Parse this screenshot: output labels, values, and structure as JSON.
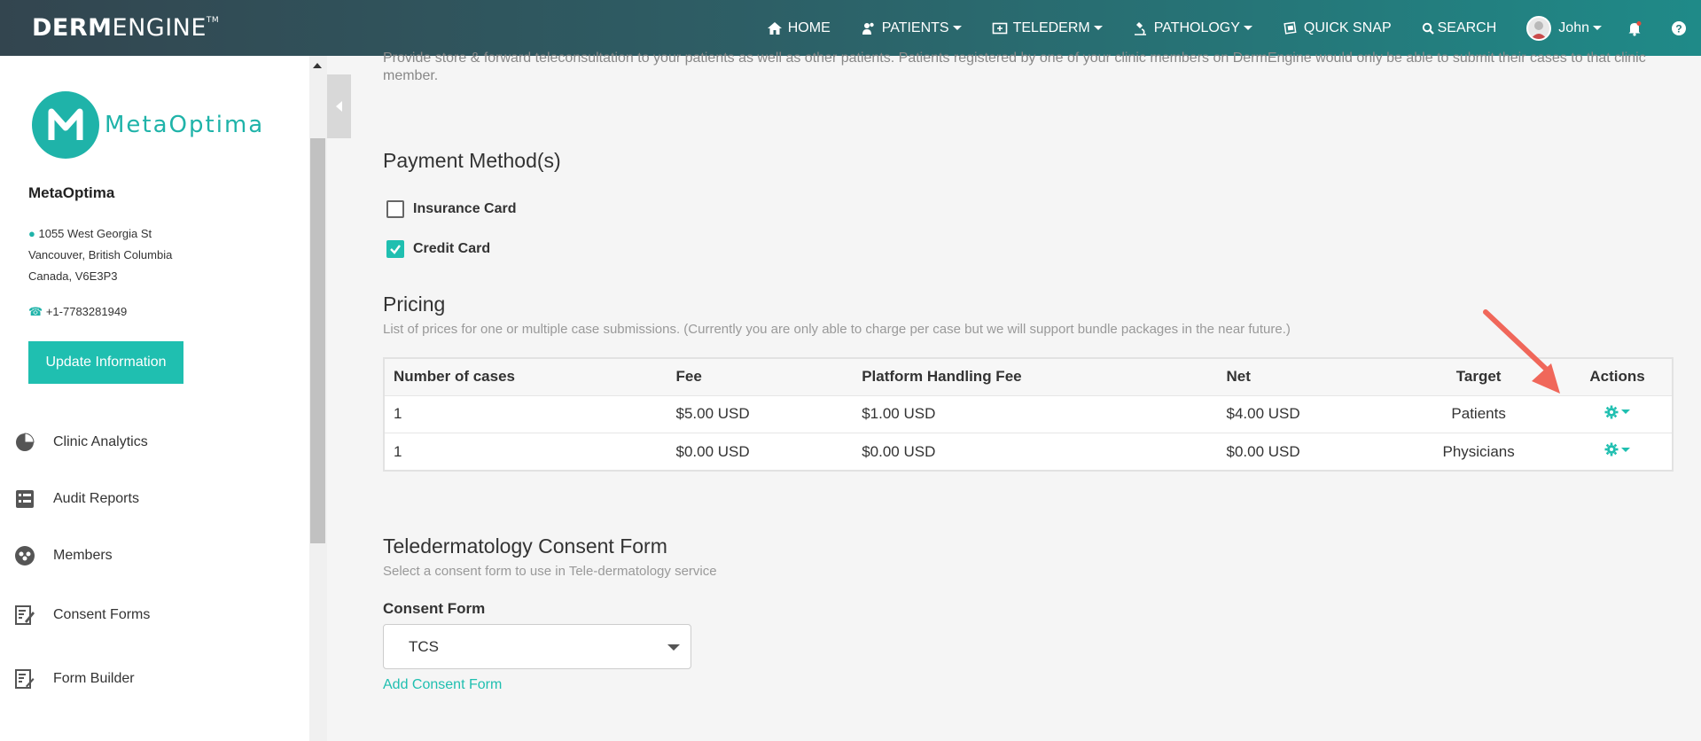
{
  "navbar": {
    "brand_bold": "DERM",
    "brand_light": "ENGINE",
    "brand_tm": "TM",
    "items": [
      {
        "label": "HOME",
        "icon": "home-icon"
      },
      {
        "label": "PATIENTS",
        "icon": "patients-icon"
      },
      {
        "label": "TELEDERM",
        "icon": "telederm-icon"
      },
      {
        "label": "PATHOLOGY",
        "icon": "microscope-icon"
      },
      {
        "label": "QUICK SNAP",
        "icon": "quick-snap-icon"
      },
      {
        "label": "SEARCH",
        "icon": "search-icon"
      }
    ],
    "user_name": "John"
  },
  "sidebar": {
    "logo_text": "MetaOptima",
    "clinic_name": "MetaOptima",
    "address": [
      "1055 West Georgia St",
      "Vancouver, British Columbia",
      "Canada, V6E3P3"
    ],
    "phone": "+1-7783281949",
    "update_button": "Update Information",
    "menu": [
      {
        "label": "Clinic Analytics",
        "icon": "pie-chart-icon"
      },
      {
        "label": "Audit Reports",
        "icon": "audit-report-icon"
      },
      {
        "label": "Members",
        "icon": "members-icon"
      },
      {
        "label": "Consent Forms",
        "icon": "consent-form-icon"
      },
      {
        "label": "Form Builder",
        "icon": "form-builder-icon"
      }
    ]
  },
  "main": {
    "intro_text": "Provide store & forward teleconsultation to your patients as well as other patients. Patients registered by one of your clinic members on DermEngine would only be able to submit their cases to that clinic member.",
    "payment": {
      "title": "Payment Method(s)",
      "options": [
        {
          "label": "Insurance Card",
          "checked": false
        },
        {
          "label": "Credit Card",
          "checked": true
        }
      ]
    },
    "pricing": {
      "title": "Pricing",
      "description": "List of prices for one or multiple case submissions. (Currently you are only able to charge per case but we will support bundle packages in the near future.)",
      "headers": [
        "Number of cases",
        "Fee",
        "Platform Handling Fee",
        "Net",
        "Target",
        "Actions"
      ],
      "rows": [
        {
          "cases": "1",
          "fee": "$5.00 USD",
          "platform_fee": "$1.00 USD",
          "net": "$4.00 USD",
          "target": "Patients"
        },
        {
          "cases": "1",
          "fee": "$0.00 USD",
          "platform_fee": "$0.00 USD",
          "net": "$0.00 USD",
          "target": "Physicians"
        }
      ]
    },
    "consent": {
      "title": "Teledermatology Consent Form",
      "description": "Select a consent form to use in Tele-dermatology service",
      "field_label": "Consent Form",
      "selected": "TCS",
      "add_link": "Add Consent Form"
    }
  },
  "colors": {
    "accent": "#1fbfb0",
    "annotation_arrow": "#f0675a"
  }
}
